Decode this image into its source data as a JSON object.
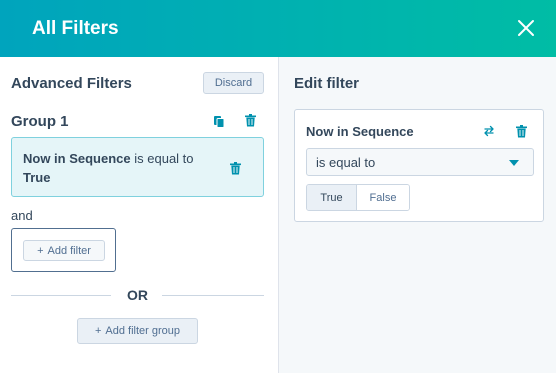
{
  "header": {
    "title": "All Filters",
    "close_icon": "close-icon"
  },
  "left_panel": {
    "title": "Advanced Filters",
    "discard_label": "Discard",
    "group": {
      "title": "Group 1",
      "filter": {
        "property": "Now in Sequence",
        "operator": "is equal to",
        "value": "True"
      },
      "and_label": "and",
      "add_filter_label": "Add filter"
    },
    "or_label": "OR",
    "add_filter_group_label": "Add filter group"
  },
  "right_panel": {
    "title": "Edit filter",
    "card": {
      "property": "Now in Sequence",
      "operator_selected": "is equal to",
      "options": [
        {
          "label": "True",
          "active": true
        },
        {
          "label": "False",
          "active": false
        }
      ]
    }
  },
  "colors": {
    "header_start": "#00a4bd",
    "header_end": "#00bda5",
    "accent": "#0091ae",
    "text": "#33475b"
  }
}
